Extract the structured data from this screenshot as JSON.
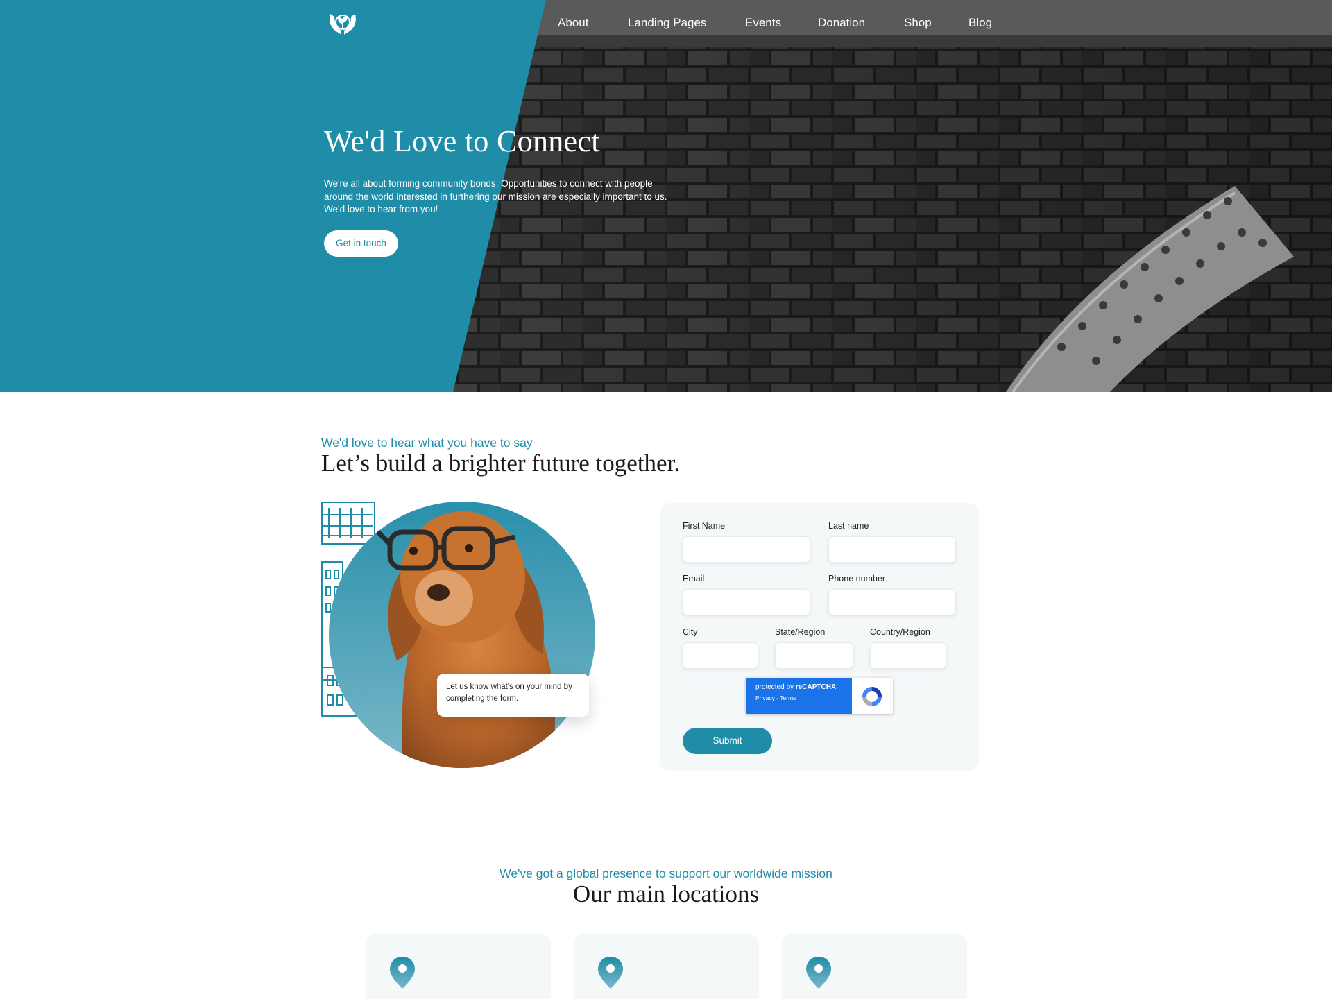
{
  "nav": {
    "logo_icon": "hands-seedling-icon",
    "items": [
      "About",
      "Landing Pages",
      "Events",
      "Donation",
      "Shop",
      "Blog"
    ]
  },
  "hero": {
    "title": "We'd Love to Connect",
    "description": "We're all about forming community bonds. Opportunities to connect with people around the world interested in furthering our mission are especially important to us. We'd love to hear from you!",
    "button_label": "Get in touch",
    "panel_color": "#1f8ca8"
  },
  "contact": {
    "eyebrow": "We'd love to hear what you have to say",
    "title": "Let’s build a brighter future together.",
    "bubble_text": "Let us know what's on your mind by completing the form.",
    "image": "dog-with-glasses-photo",
    "form": {
      "first_name_label": "First Name",
      "last_name_label": "Last name",
      "email_label": "Email",
      "phone_label": "Phone number",
      "city_label": "City",
      "state_label": "State/Region",
      "country_label": "Country/Region",
      "first_name_value": "",
      "last_name_value": "",
      "email_value": "",
      "phone_value": "",
      "city_value": "",
      "state_value": "",
      "country_value": "",
      "captcha_text": "protected by",
      "captcha_brand": "reCAPTCHA",
      "captcha_links": "Privacy - Terms",
      "submit_label": "Submit"
    }
  },
  "locations": {
    "eyebrow": "We've got a global presence to support our worldwide mission",
    "title": "Our main locations",
    "card_icon": "map-pin-icon",
    "card_count": 3
  },
  "colors": {
    "accent": "#1f8ca8",
    "card_bg": "#f4f8f9",
    "recaptcha_blue": "#1a73e8"
  }
}
